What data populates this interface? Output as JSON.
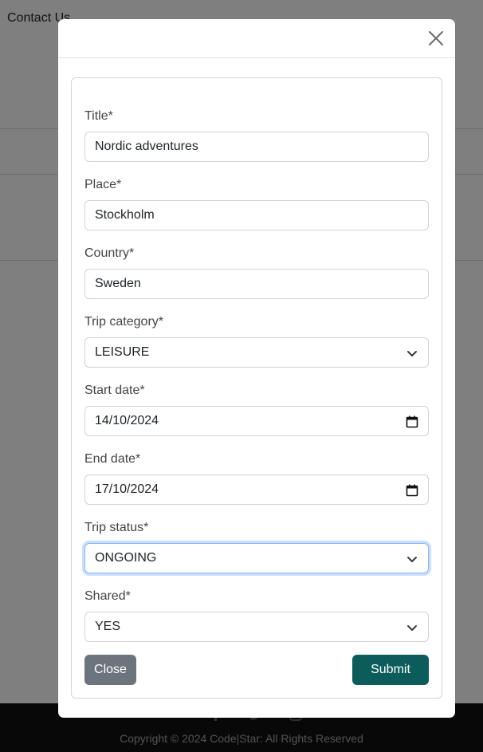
{
  "background": {
    "nav_link": "Contact Us",
    "footer": {
      "copyright": "Copyright © 2024 Code|Star: All Rights Reserved",
      "icons": [
        "facebook-icon",
        "twitter-icon",
        "instagram-icon"
      ]
    }
  },
  "modal": {
    "close_icon": "close-icon",
    "fields": {
      "title": {
        "label": "Title*",
        "value": "Nordic adventures"
      },
      "place": {
        "label": "Place*",
        "value": "Stockholm"
      },
      "country": {
        "label": "Country*",
        "value": "Sweden"
      },
      "trip_category": {
        "label": "Trip category*",
        "value": "LEISURE",
        "icon": "chevron-down-icon"
      },
      "start_date": {
        "label": "Start date*",
        "value": "14/10/2024",
        "icon": "calendar-icon"
      },
      "end_date": {
        "label": "End date*",
        "value": "17/10/2024",
        "icon": "calendar-icon"
      },
      "trip_status": {
        "label": "Trip status*",
        "value": "ONGOING",
        "icon": "chevron-down-icon"
      },
      "shared": {
        "label": "Shared*",
        "value": "YES",
        "icon": "chevron-down-icon"
      }
    },
    "buttons": {
      "close_label": "Close",
      "submit_label": "Submit"
    }
  },
  "colors": {
    "submit": "#0d5c5c",
    "close": "#6c757d",
    "focus_border": "#86b7fe"
  }
}
